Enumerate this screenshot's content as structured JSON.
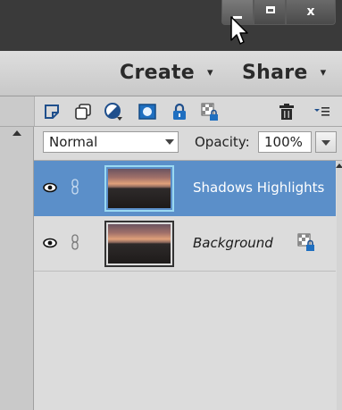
{
  "window": {
    "minimize_icon": "minimize-icon",
    "maximize_icon": "maximize-icon",
    "close_label": "x"
  },
  "menubar": {
    "create_label": "Create",
    "create_caret": "▾",
    "share_label": "Share",
    "share_caret": "▾"
  },
  "toolbar": {
    "icons": [
      "new-layer-icon",
      "new-group-icon",
      "adjustment-layer-icon",
      "layer-mask-icon",
      "lock-all-icon",
      "lock-transparency-icon",
      "delete-layer-icon",
      "panel-menu-icon"
    ]
  },
  "blend": {
    "mode": "Normal",
    "opacity_label": "Opacity:",
    "opacity_value": "100%"
  },
  "layers": [
    {
      "name": "Shadows Highlights",
      "selected": true
    },
    {
      "name": "Background",
      "selected": false,
      "locked": true
    }
  ],
  "colors": {
    "selection": "#5b8fc9",
    "titlebar": "#3a3a3a"
  }
}
